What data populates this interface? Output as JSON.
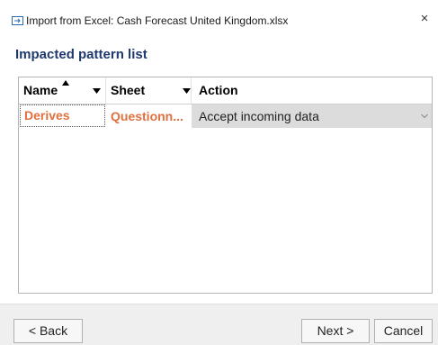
{
  "window": {
    "title": "Import from Excel: Cash Forecast United Kingdom.xlsx",
    "close_label": "×"
  },
  "section": {
    "title": "Impacted pattern list"
  },
  "grid": {
    "columns": [
      {
        "label": "Name",
        "sorted": "ascending",
        "filter": true
      },
      {
        "label": "Sheet",
        "filter": true
      },
      {
        "label": "Action"
      }
    ],
    "rows": [
      {
        "name": "Derives",
        "sheet": "Questionn...",
        "action": "Accept incoming data"
      }
    ]
  },
  "buttons": {
    "back": "< Back",
    "next": "Next >",
    "cancel": "Cancel"
  },
  "colors": {
    "title_accent": "#1f3a6e",
    "highlight_text": "#e07040",
    "dropdown_bg": "#dcdcdc"
  }
}
